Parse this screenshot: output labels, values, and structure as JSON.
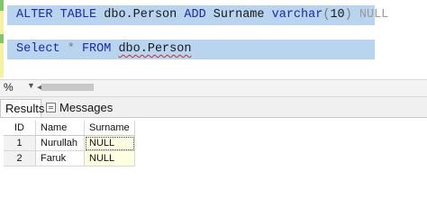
{
  "editor": {
    "line1": {
      "kw_alter": "ALTER",
      "kw_table": "TABLE",
      "table": "dbo.Person",
      "kw_add": "ADD",
      "column": "Surname",
      "type": "varchar",
      "paren_open": "(",
      "length": "10",
      "paren_close": ")",
      "kw_null": "NULL"
    },
    "line2": {
      "kw_select": "Select",
      "star": "*",
      "kw_from": "FROM",
      "table": "dbo.Person"
    }
  },
  "zoom": {
    "value": "%",
    "dropdown_arrow": "▼"
  },
  "tabs": {
    "results": "Results",
    "messages": "Messages"
  },
  "grid": {
    "headers": [
      "ID",
      "Name",
      "Surname"
    ],
    "rows": [
      {
        "rownum": "1",
        "name": "Nurullah",
        "surname": "NULL"
      },
      {
        "rownum": "2",
        "name": "Faruk",
        "surname": "NULL"
      }
    ]
  },
  "colors": {
    "selection": "#b8d4ef",
    "keyword": "#1f2aa8",
    "null_cell": "#ffffe1"
  }
}
